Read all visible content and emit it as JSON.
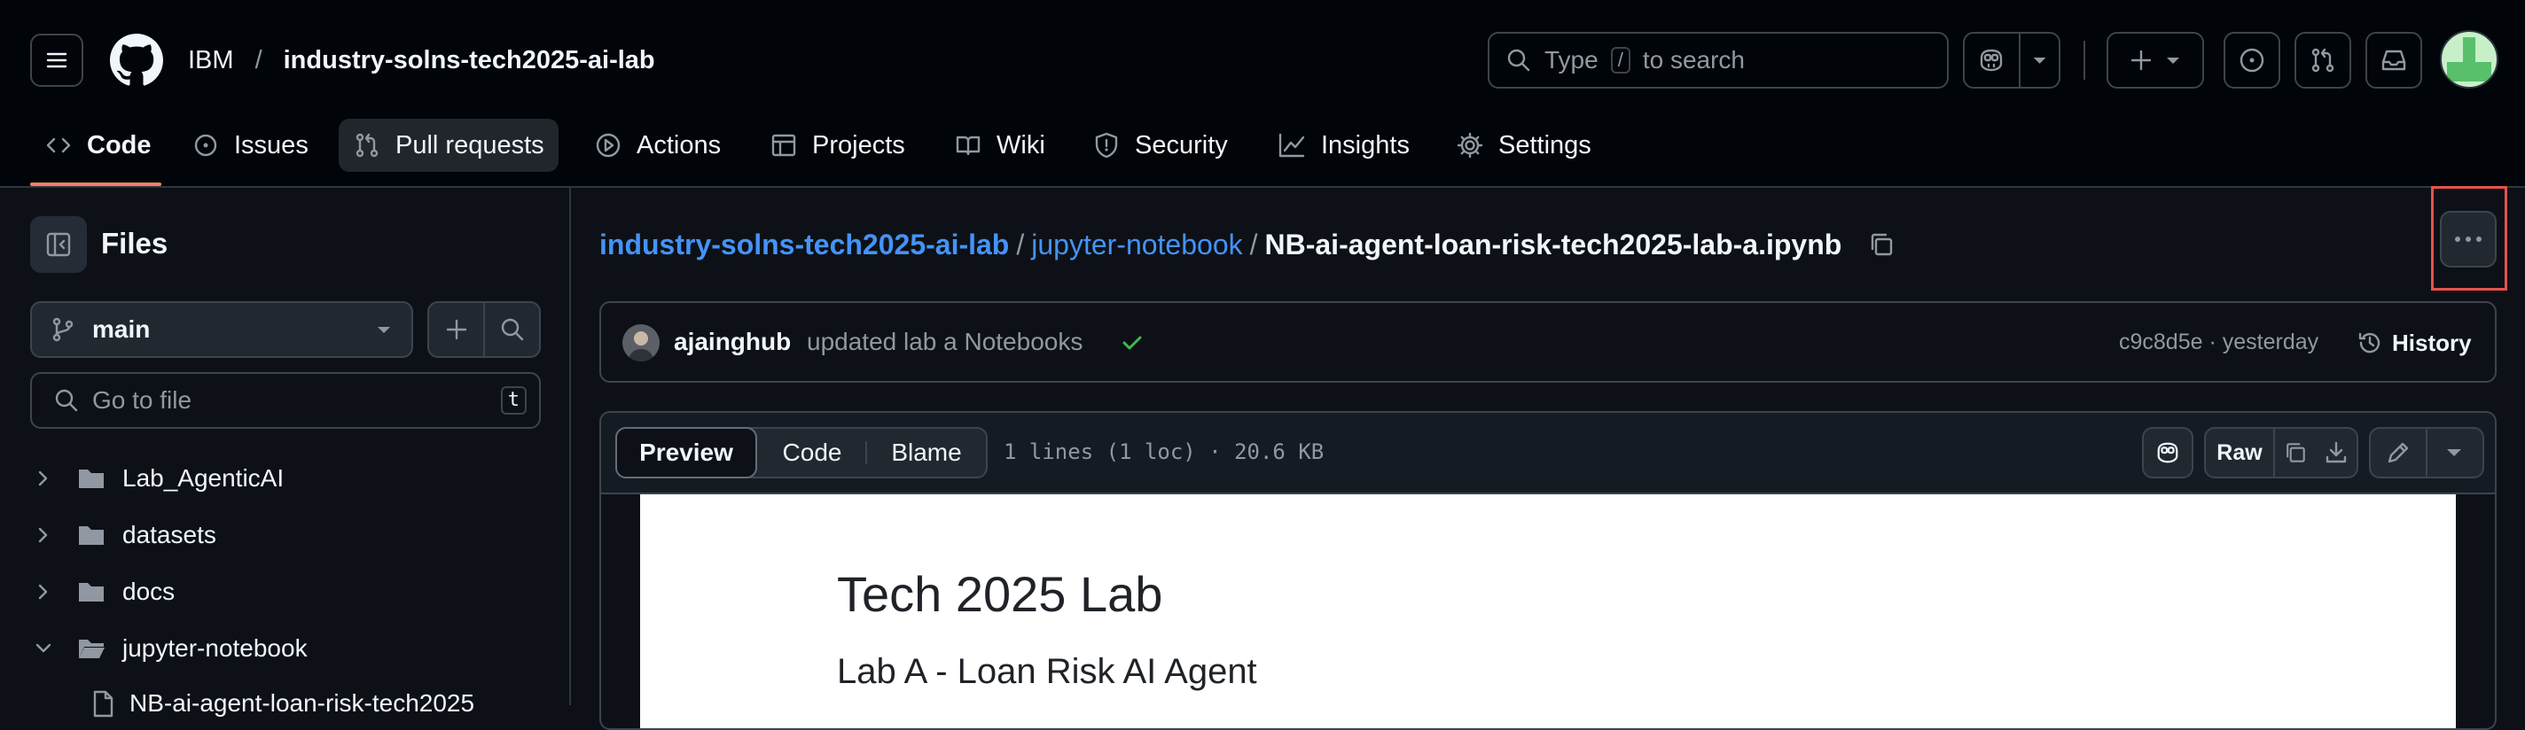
{
  "header": {
    "owner": "IBM",
    "separator": "/",
    "repo": "industry-solns-tech2025-ai-lab",
    "search": {
      "type_label": "Type",
      "key": "/",
      "to_search": "to search"
    }
  },
  "tabs": [
    {
      "label": "Code",
      "icon": "code-icon"
    },
    {
      "label": "Issues",
      "icon": "issue-icon"
    },
    {
      "label": "Pull requests",
      "icon": "pull-request-icon"
    },
    {
      "label": "Actions",
      "icon": "play-icon"
    },
    {
      "label": "Projects",
      "icon": "table-icon"
    },
    {
      "label": "Wiki",
      "icon": "book-icon"
    },
    {
      "label": "Security",
      "icon": "shield-icon"
    },
    {
      "label": "Insights",
      "icon": "graph-icon"
    },
    {
      "label": "Settings",
      "icon": "gear-icon"
    }
  ],
  "sidebar": {
    "title": "Files",
    "branch": "main",
    "goto_placeholder": "Go to file",
    "goto_key": "t",
    "items": [
      {
        "label": "Lab_AgenticAI",
        "expanded": false
      },
      {
        "label": "datasets",
        "expanded": false
      },
      {
        "label": "docs",
        "expanded": false
      },
      {
        "label": "jupyter-notebook",
        "expanded": true
      },
      {
        "label": "NB-ai-agent-loan-risk-tech2025"
      }
    ]
  },
  "breadcrumb": {
    "repo": "industry-solns-tech2025-ai-lab",
    "folder": "jupyter-notebook",
    "file": "NB-ai-agent-loan-risk-tech2025-lab-a.ipynb",
    "sep": "/"
  },
  "commit": {
    "author": "ajainghub",
    "message": "updated lab a Notebooks",
    "sha_time": "c9c8d5e · yesterday",
    "history_label": "History"
  },
  "file_toolbar": {
    "preview": "Preview",
    "code": "Code",
    "blame": "Blame",
    "info": "1 lines (1 loc) · 20.6 KB",
    "raw": "Raw"
  },
  "notebook": {
    "h1": "Tech 2025 Lab",
    "h2": "Lab A - Loan Risk AI Agent"
  },
  "colors": {
    "accent_link": "#4493f8",
    "highlight_box": "#e5534b",
    "check": "#3fb950",
    "tab_underline": "#f78166"
  }
}
